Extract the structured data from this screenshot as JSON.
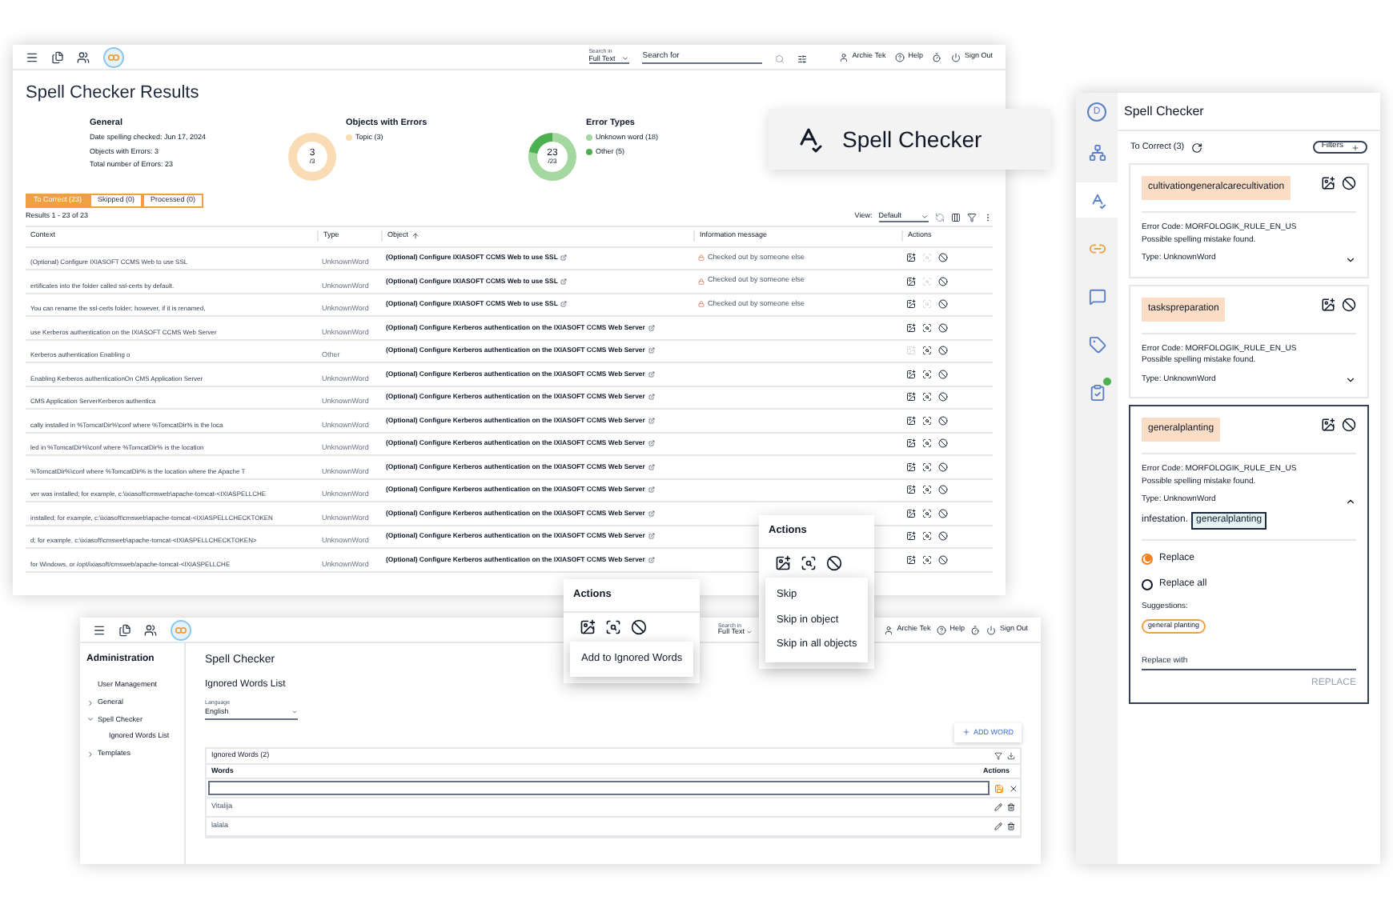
{
  "results_window": {
    "header": {
      "search_in_label": "Search in",
      "search_scope": "Full Text",
      "search_placeholder": "Search for",
      "user": "Archie Tek",
      "help": "Help",
      "sign_out": "Sign Out"
    },
    "title": "Spell Checker Results",
    "summary": {
      "general": {
        "title": "General",
        "lines": [
          "Date spelling checked: Jun 17, 2024",
          "Objects with Errors: 3",
          "Total number of Errors: 23"
        ]
      },
      "objects_with_errors": {
        "title": "Objects with Errors",
        "center": "3",
        "center_sub": "/3",
        "legend": [
          {
            "label": "Topic (3)",
            "color": "#f9dcb4"
          }
        ]
      },
      "error_types": {
        "center": "23",
        "center_sub": "/23",
        "slices": [
          {
            "color": "#a5d8a0"
          },
          {
            "color": "#4caf50"
          }
        ],
        "chart_data": {
          "type": "donut",
          "title": "Error Types",
          "categories": [
            "Unknown word (18)",
            "Other (5)"
          ],
          "values": [
            18,
            5
          ]
        }
      }
    },
    "tabs": [
      {
        "label": "To Correct (23)",
        "selected": true
      },
      {
        "label": "Skipped (0)",
        "selected": false
      },
      {
        "label": "Processed (0)",
        "selected": false
      }
    ],
    "results": "Results 1 - 23 of 23",
    "view_label": "View:",
    "view_value": "Default",
    "columns": [
      "Context",
      "Type",
      "Object",
      "Information message",
      "Actions"
    ],
    "rows": [
      {
        "context": "(Optional) Configure IXIASOFT CCMS Web to use SSL",
        "type": "UnknownWord",
        "object": "(Optional) Configure IXIASOFT CCMS Web to use SSL",
        "info": "Checked out by someone else",
        "add_disabled": false,
        "find_disabled": true
      },
      {
        "context": "ertificates into the folder called ssl-certs by default.",
        "type": "UnknownWord",
        "object": "(Optional) Configure IXIASOFT CCMS Web to use SSL",
        "info": "Checked out by someone else",
        "add_disabled": false,
        "find_disabled": true
      },
      {
        "context": "You can rename the ssl-certs folder; however, if it is renamed,",
        "type": "UnknownWord",
        "object": "(Optional) Configure IXIASOFT CCMS Web to use SSL",
        "info": "Checked out by someone else",
        "add_disabled": false,
        "find_disabled": true
      },
      {
        "context": "use Kerberos authentication on the IXIASOFT CCMS Web Server",
        "type": "UnknownWord",
        "object": "(Optional) Configure Kerberos authentication on the IXIASOFT CCMS Web Server",
        "add_disabled": false,
        "find_disabled": false
      },
      {
        "context": "Kerberos authentication Enabling o",
        "type": "Other",
        "object": "(Optional) Configure Kerberos authentication on the IXIASOFT CCMS Web Server",
        "add_disabled": true,
        "find_disabled": false
      },
      {
        "context": "Enabling Kerberos authenticationOn CMS Application Server",
        "type": "UnknownWord",
        "object": "(Optional) Configure Kerberos authentication on the IXIASOFT CCMS Web Server",
        "add_disabled": false,
        "find_disabled": false
      },
      {
        "context": "CMS Application ServerKerberos authentica",
        "type": "UnknownWord",
        "object": "(Optional) Configure Kerberos authentication on the IXIASOFT CCMS Web Server",
        "add_disabled": false,
        "find_disabled": false
      },
      {
        "context": "cally installed in %TomcatDir%\\conf where %TomcatDir% is the loca",
        "type": "UnknownWord",
        "object": "(Optional) Configure Kerberos authentication on the IXIASOFT CCMS Web Server",
        "add_disabled": false,
        "find_disabled": false
      },
      {
        "context": "led in %TomcatDir%\\conf where %TomcatDir% is the location",
        "type": "UnknownWord",
        "object": "(Optional) Configure Kerberos authentication on the IXIASOFT CCMS Web Server",
        "add_disabled": false,
        "find_disabled": false
      },
      {
        "context": "%TomcatDir%\\conf where %TomcatDir% is the location where the Apache T",
        "type": "UnknownWord",
        "object": "(Optional) Configure Kerberos authentication on the IXIASOFT CCMS Web Server",
        "add_disabled": false,
        "find_disabled": false
      },
      {
        "context": "ver was installed; for example, c:\\ixiasoft\\cmsweb\\apache-tomcat-<IXIASPELLCHE",
        "type": "UnknownWord",
        "object": "(Optional) Configure Kerberos authentication on the IXIASOFT CCMS Web Server",
        "add_disabled": false,
        "find_disabled": false
      },
      {
        "context": "installed; for example, c:\\ixiasoft\\cmsweb\\apache-tomcat-<IXIASPELLCHECKTOKEN",
        "type": "UnknownWord",
        "object": "(Optional) Configure Kerberos authentication on the IXIASOFT CCMS Web Server",
        "add_disabled": false,
        "find_disabled": false
      },
      {
        "context": "d; for example, c:\\ixiasoft\\cmsweb\\apache-tomcat-<IXIASPELLCHECKTOKEN>",
        "type": "UnknownWord",
        "object": "(Optional) Configure Kerberos authentication on the IXIASOFT CCMS Web Server",
        "add_disabled": false,
        "find_disabled": false
      },
      {
        "context": "for Windows, or /opt/ixiasoft/cmsweb/apache-tomcat-<IXIASPELLCHE",
        "type": "UnknownWord",
        "object": "(Optional) Configure Kerberos authentication on the IXIASOFT CCMS Web Server",
        "add_disabled": false,
        "find_disabled": false
      }
    ]
  },
  "feature_tag": {
    "label": "Spell Checker"
  },
  "admin_window": {
    "header": {
      "search_in_label": "Search in",
      "search_scope": "Full Text",
      "user": "Archie Tek",
      "help": "Help",
      "sign_out": "Sign Out"
    },
    "sidebar": {
      "title": "Administration",
      "items": [
        {
          "label": "User Management",
          "has_children": false
        },
        {
          "label": "General",
          "expanded": false,
          "has_children": true
        },
        {
          "label": "Spell Checker",
          "expanded": true,
          "has_children": true,
          "children": [
            {
              "label": "Ignored Words List"
            }
          ]
        },
        {
          "label": "Templates",
          "expanded": false,
          "has_children": true
        }
      ]
    },
    "title": "Spell Checker",
    "subtitle": "Ignored Words List",
    "language_label": "Language",
    "language_value": "English",
    "add_button": "ADD WORD",
    "table_title": "Ignored Words (2)",
    "columns": [
      "Words",
      "Actions"
    ],
    "words": [
      "Vitalija",
      "lalala"
    ]
  },
  "actions_popup_ignore": {
    "title": "Actions",
    "menu": [
      "Add to Ignored Words"
    ]
  },
  "actions_popup_skip": {
    "title": "Actions",
    "menu": [
      "Skip",
      "Skip in object",
      "Skip in all objects"
    ]
  },
  "side_panel": {
    "rail": [
      {
        "kind": "avatar",
        "label": "D",
        "selected": false
      },
      {
        "kind": "tree",
        "selected": false
      },
      {
        "kind": "spell",
        "selected": true
      },
      {
        "kind": "link",
        "selected": false
      },
      {
        "kind": "comment",
        "selected": false
      },
      {
        "kind": "tag",
        "selected": false
      },
      {
        "kind": "checklist",
        "selected": false
      }
    ],
    "title": "Spell Checker",
    "to_correct": "To Correct (3)",
    "filters": "Filters",
    "cards": [
      {
        "word": "cultivationgeneralcarecultivation",
        "error_code": "Error Code: MORFOLOGIK_RULE_EN_US",
        "message": "Possible spelling mistake found.",
        "type": "Type: UnknownWord",
        "expanded": false,
        "selected": false
      },
      {
        "word": "taskspreparation",
        "error_code": "Error Code: MORFOLOGIK_RULE_EN_US",
        "message": "Possible spelling mistake found.",
        "type": "Type: UnknownWord",
        "expanded": false,
        "selected": false
      },
      {
        "word": "generalplanting",
        "error_code": "Error Code: MORFOLOGIK_RULE_EN_US",
        "message": "Possible spelling mistake found.",
        "type": "Type: UnknownWord",
        "expanded": true,
        "selected": true,
        "context": "infestation.",
        "context_word": "generalplanting",
        "options": [
          {
            "label": "Replace",
            "selected": true
          },
          {
            "label": "Replace all",
            "selected": false
          }
        ],
        "suggestions_label": "Suggestions:",
        "suggestions": [
          "general planting"
        ],
        "replace_placeholder": "Replace with",
        "replace_button": "REPLACE",
        "replace_disabled": true
      }
    ]
  }
}
